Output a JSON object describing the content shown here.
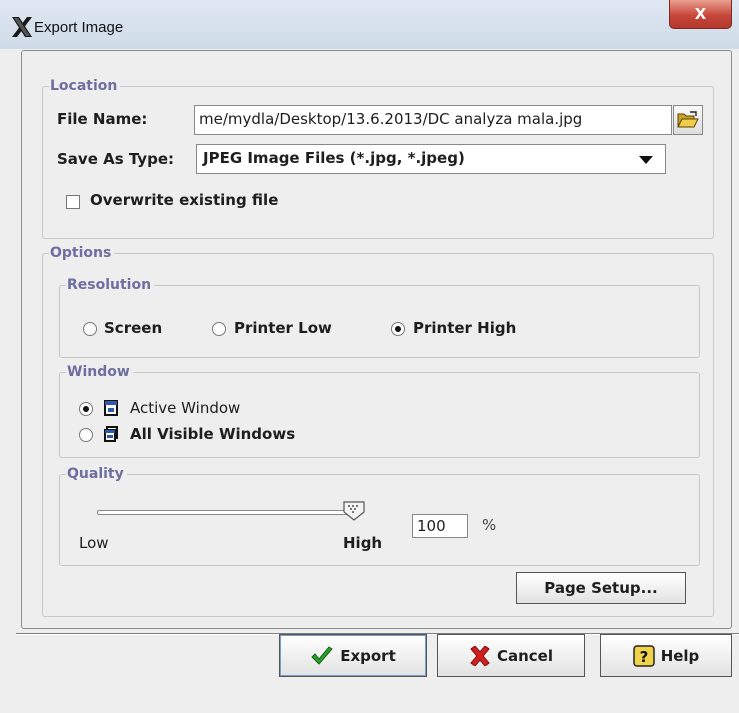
{
  "window": {
    "title": "Export Image",
    "close_glyph": "X",
    "app_icon": "x11-x-icon"
  },
  "location": {
    "legend": "Location",
    "file_name_label": "File Name:",
    "file_name_value": "me/mydla/Desktop/13.6.2013/DC analyza mala.jpg",
    "browse_icon": "folder-open-icon",
    "save_as_label": "Save As Type:",
    "save_as_value": "JPEG Image Files (*.jpg, *.jpeg)",
    "overwrite_label": "Overwrite existing file",
    "overwrite_checked": false
  },
  "options": {
    "legend": "Options",
    "resolution": {
      "legend": "Resolution",
      "items": [
        {
          "label": "Screen",
          "selected": false
        },
        {
          "label": "Printer Low",
          "selected": false
        },
        {
          "label": "Printer High",
          "selected": true
        }
      ]
    },
    "window_group": {
      "legend": "Window",
      "items": [
        {
          "label": "Active Window",
          "selected": true,
          "icon": "single-window-icon"
        },
        {
          "label": "All Visible Windows",
          "selected": false,
          "icon": "stacked-windows-icon"
        }
      ]
    },
    "quality": {
      "legend": "Quality",
      "low_label": "Low",
      "high_label": "High",
      "level_fraction": 1.0,
      "value": "100",
      "unit": "%"
    },
    "page_setup_label": "Page Setup..."
  },
  "buttons": {
    "export_label": "Export",
    "cancel_label": "Cancel",
    "help_label": "Help",
    "export_icon": "checkmark-icon",
    "cancel_icon": "red-x-icon",
    "help_icon": "question-icon"
  },
  "colors": {
    "legend": "#6e6ea0",
    "close": "#c7473a",
    "check": "#2aa02a"
  }
}
